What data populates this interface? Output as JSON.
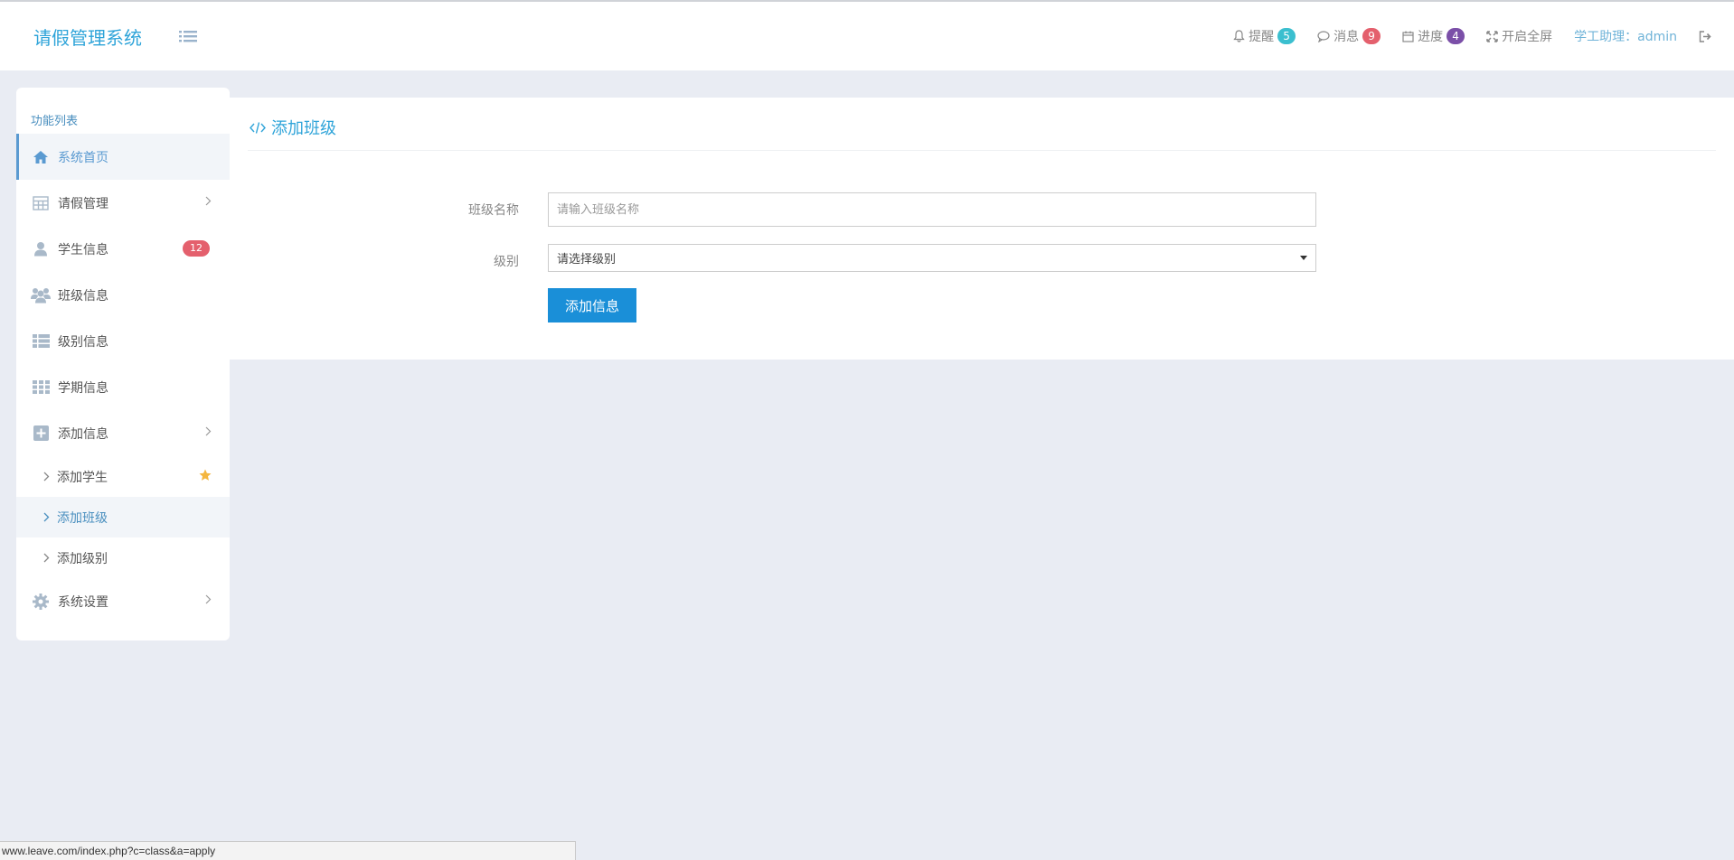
{
  "header": {
    "brand": "请假管理系统",
    "items": [
      {
        "label": "提醒",
        "badge": "5",
        "badge_color": "#3bbfcf"
      },
      {
        "label": "消息",
        "badge": "9",
        "badge_color": "#e4606d"
      },
      {
        "label": "进度",
        "badge": "4",
        "badge_color": "#7b4fa8"
      },
      {
        "label": "开启全屏"
      }
    ],
    "user": "学工助理：admin"
  },
  "sidebar": {
    "title": "功能列表",
    "items": [
      {
        "label": "系统首页"
      },
      {
        "label": "请假管理"
      },
      {
        "label": "学生信息",
        "badge": "12"
      },
      {
        "label": "班级信息"
      },
      {
        "label": "级别信息"
      },
      {
        "label": "学期信息"
      },
      {
        "label": "添加信息"
      }
    ],
    "sub_items": [
      {
        "label": "添加学生"
      },
      {
        "label": "添加班级"
      },
      {
        "label": "添加级别"
      }
    ],
    "settings": {
      "label": "系统设置"
    }
  },
  "panel": {
    "title": "添加班级",
    "class_name_label": "班级名称",
    "class_name_placeholder": "请输入班级名称",
    "level_label": "级别",
    "level_selected": "请选择级别",
    "submit_label": "添加信息"
  },
  "statusbar": {
    "url": "www.leave.com/index.php?c=class&a=apply"
  }
}
